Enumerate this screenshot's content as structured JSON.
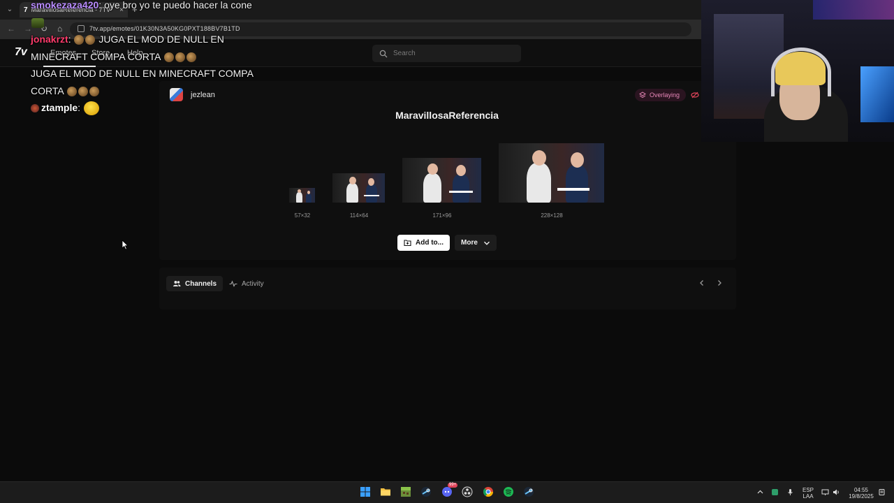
{
  "browser": {
    "tab_title": "MaravillosaReferencia - 7TV",
    "tab_favicon": "7",
    "tab_close": "×",
    "new_tab": "+",
    "url": "7tv.app/emotes/01K30N3A50KG0PXT188BV7B1TD"
  },
  "header": {
    "logo": "7v",
    "nav": [
      "Emotes",
      "Store",
      "Help"
    ],
    "search_placeholder": "Search"
  },
  "chat": [
    {
      "user": "smokezaza420",
      "user_color": "#b98cff",
      "text": " oye bro yo te puedo hacer la cone "
    },
    {
      "user": "jonakrzt",
      "user_color": "#ff3b6b",
      "text": " JUGA EL MOD DE NULL EN MINECRAFT COMPA CORTA "
    },
    {
      "text": "JUGA EL MOD DE NULL EN MINECRAFT COMPA CORTA "
    },
    {
      "user": "ztample",
      "user_color": "#ffffff",
      "text": " "
    }
  ],
  "emote": {
    "owner": "jezlean",
    "status_label": "Overlaying",
    "status_color": "#e887b8",
    "title": "MaravillosaReferencia",
    "sizes": [
      "57×32",
      "114×64",
      "171×96",
      "228×128"
    ],
    "add_label": "Add to...",
    "more_label": "More"
  },
  "tabs": {
    "channels": "Channels",
    "activity": "Activity"
  },
  "taskbar": {
    "lang_top": "ESP",
    "lang_bottom": "LAA",
    "time": "04:55",
    "date": "19/8/2025",
    "discord_badge": "99+"
  }
}
